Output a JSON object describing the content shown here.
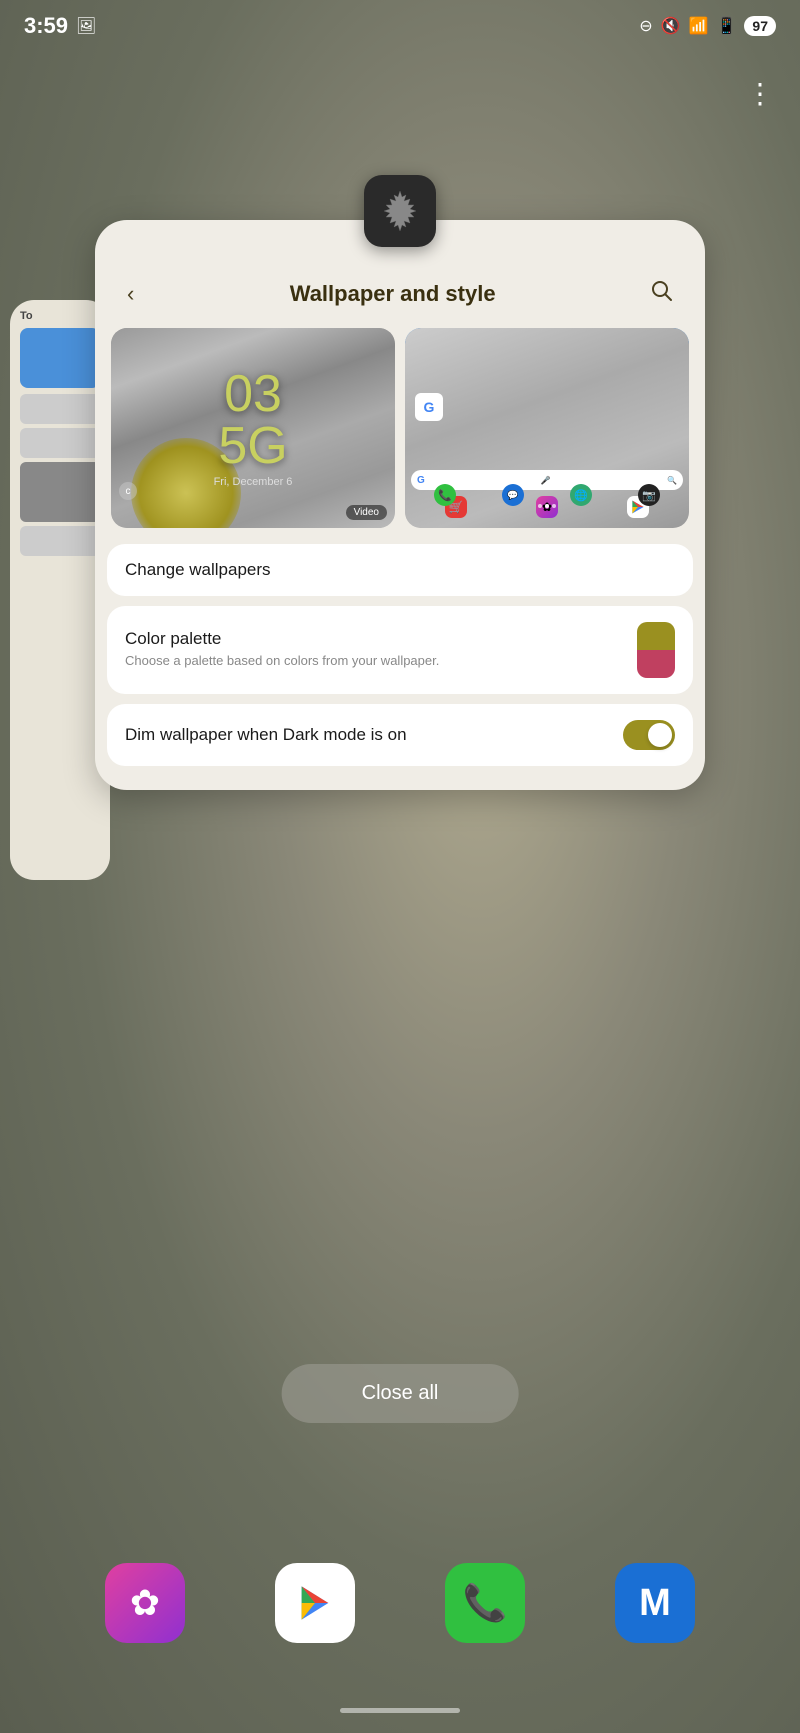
{
  "statusBar": {
    "time": "3:59",
    "battery": "97"
  },
  "threeDotsMenu": "⋮",
  "settingsCard": {
    "title": "Wallpaper and style",
    "backLabel": "‹",
    "searchLabel": "🔍"
  },
  "lockScreen": {
    "timeBig": "03\n5G",
    "timeDisplay": "03",
    "time2": "5G",
    "date": "Fri, December 6",
    "videoBadge": "Video"
  },
  "items": {
    "changeWallpaper": "Change wallpapers",
    "colorPalette": "Color palette",
    "colorPaletteDesc": "Choose a palette based on colors from your wallpaper.",
    "dimWallpaper": "Dim wallpaper when Dark mode is on"
  },
  "closeAll": "Close all",
  "dock": {
    "gallery": "✿",
    "phone": "📞",
    "messages": "M"
  },
  "homeIndicator": ""
}
